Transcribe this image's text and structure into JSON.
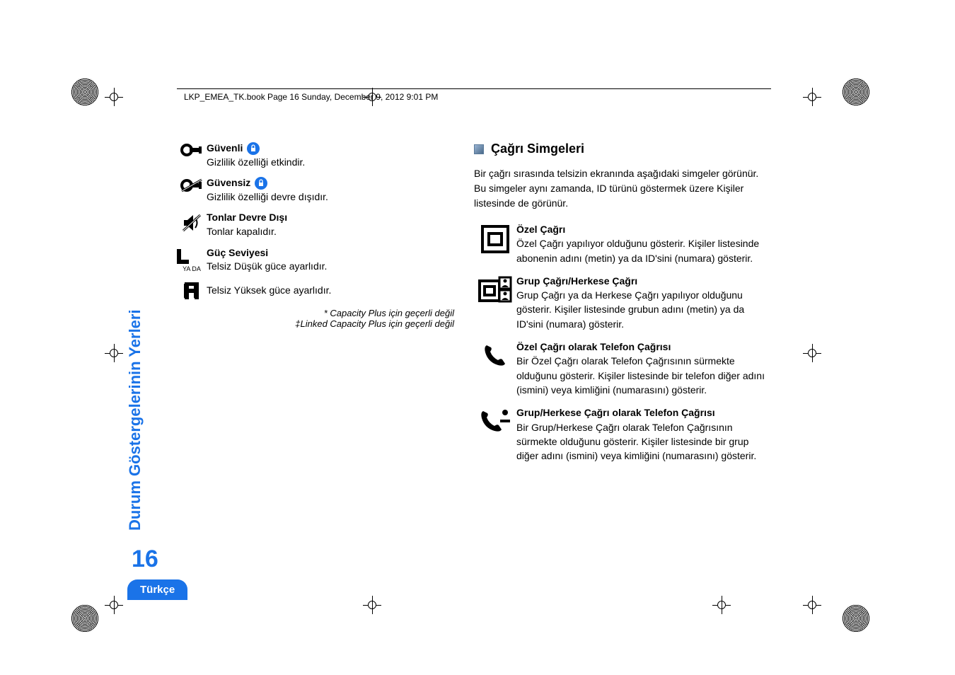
{
  "header": "LKP_EMEA_TK.book  Page 16  Sunday, December 9, 2012  9:01 PM",
  "sidebar_title": "Durum Göstergelerinin Yerleri",
  "page_number": "16",
  "language": "Türkçe",
  "left": {
    "guvenli": {
      "title": "Güvenli",
      "desc": "Gizlilik özelliği etkindir."
    },
    "guvensiz": {
      "title": "Güvensiz",
      "desc": "Gizlilik özelliği devre dışıdır."
    },
    "tonlar": {
      "title": "Tonlar Devre Dışı",
      "desc": "Tonlar kapalıdır."
    },
    "guc": {
      "title": "Güç Seviyesi",
      "desc": "Telsiz Düşük güce ayarlıdır."
    },
    "high": "Telsiz Yüksek güce ayarlıdır.",
    "ya_da": "YA DA",
    "fn1": "* Capacity Plus için geçerli değil",
    "fn2": "‡Linked Capacity Plus için geçerli değil"
  },
  "right": {
    "heading": "Çağrı Simgeleri",
    "intro": "Bir çağrı sırasında telsizin ekranında aşağıdaki simgeler görünür. Bu simgeler aynı zamanda, ID türünü göstermek üzere Kişiler listesinde de görünür.",
    "ozel": {
      "title": "Özel Çağrı",
      "desc": "Özel Çağrı yapılıyor olduğunu gösterir. Kişiler listesinde abonenin adını (metin) ya da ID'sini (numara) gösterir."
    },
    "grup": {
      "title": "Grup Çağrı/Herkese Çağrı",
      "desc": "Grup Çağrı ya da Herkese Çağrı yapılıyor olduğunu gösterir. Kişiler listesinde grubun adını (metin) ya da ID'sini (numara) gösterir."
    },
    "ozel_tel": {
      "title": "Özel Çağrı olarak Telefon Çağrısı",
      "desc": "Bir Özel Çağrı olarak Telefon Çağrısının sürmekte olduğunu gösterir. Kişiler listesinde bir telefon diğer adını (ismini) veya kimliğini (numarasını) gösterir."
    },
    "grup_tel": {
      "title": "Grup/Herkese Çağrı olarak Telefon Çağrısı",
      "desc": "Bir Grup/Herkese Çağrı olarak Telefon Çağrısının sürmekte olduğunu gösterir. Kişiler listesinde bir grup diğer adını (ismini) veya kimliğini (numarasını) gösterir."
    }
  }
}
